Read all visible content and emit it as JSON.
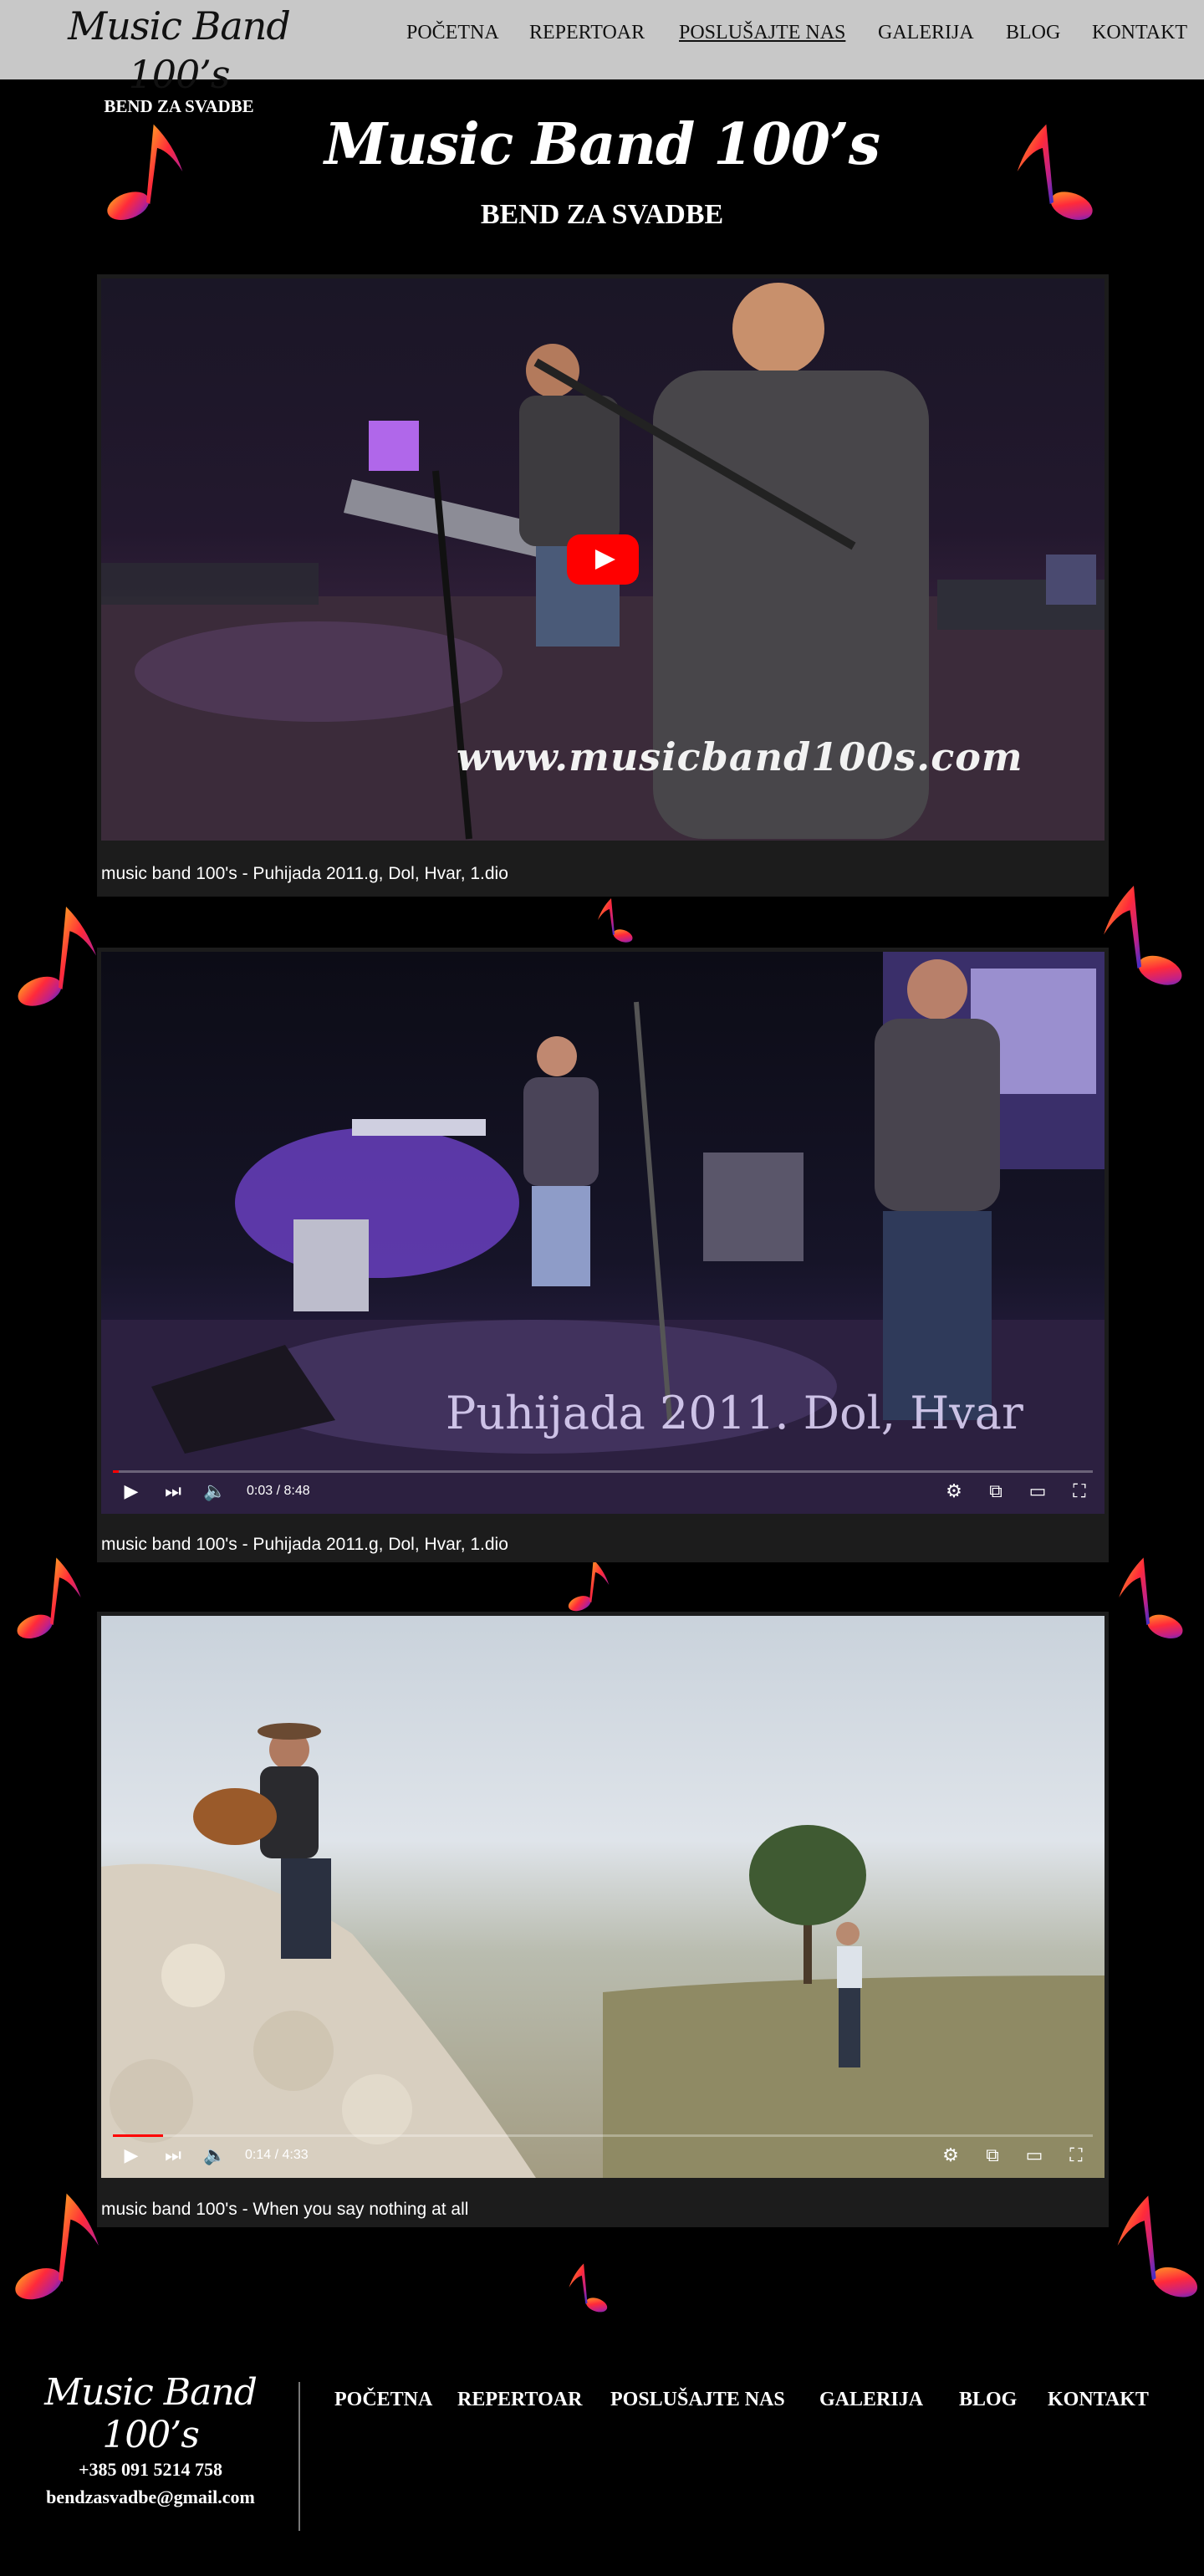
{
  "header": {
    "logo_title": "Music Band 100’s",
    "logo_subtitle": "BEND ZA SVADBE",
    "nav": [
      "POČETNA",
      "REPERTOAR",
      "POSLUŠAJTE NAS",
      "GALERIJA",
      "BLOG",
      "KONTAKT"
    ],
    "active_nav": "POSLUŠAJTE NAS"
  },
  "hero": {
    "title": "Music Band 100’s",
    "subtitle": "BEND ZA SVADBE"
  },
  "videos": [
    {
      "caption": "music band 100's - Puhijada 2011.g, Dol, Hvar, 1.dio",
      "watermark": "www.musicband100s.com",
      "state": "thumbnail"
    },
    {
      "caption": "music band 100's - Puhijada 2011.g, Dol, Hvar, 1.dio",
      "overlay_text": "Puhijada 2011. Dol, Hvar",
      "time": "0:03 / 8:48",
      "progress": 0.006,
      "state": "paused"
    },
    {
      "caption": "music band 100's - When you say nothing at all",
      "time": "0:14 / 4:33",
      "progress": 0.051,
      "state": "paused"
    }
  ],
  "footer": {
    "logo_title": "Music Band 100’s",
    "phone": "+385 091 5214 758",
    "email": "bendzasvadbe@gmail.com",
    "nav": [
      "POČETNA",
      "REPERTOAR",
      "POSLUŠAJTE NAS",
      "GALERIJA",
      "BLOG",
      "KONTAKT"
    ]
  },
  "icons": {
    "music_note": "music-note-icon",
    "play": "play-icon",
    "next": "next-icon",
    "volume": "volume-icon",
    "settings": "gear-icon",
    "miniplayer": "miniplayer-icon",
    "theater": "theater-mode-icon",
    "fullscreen": "fullscreen-icon"
  },
  "colors": {
    "header_bg": "#c8c8c8",
    "page_bg": "#000000",
    "youtube_red": "#ff0000",
    "caption_bar": "#1c1c1c"
  }
}
